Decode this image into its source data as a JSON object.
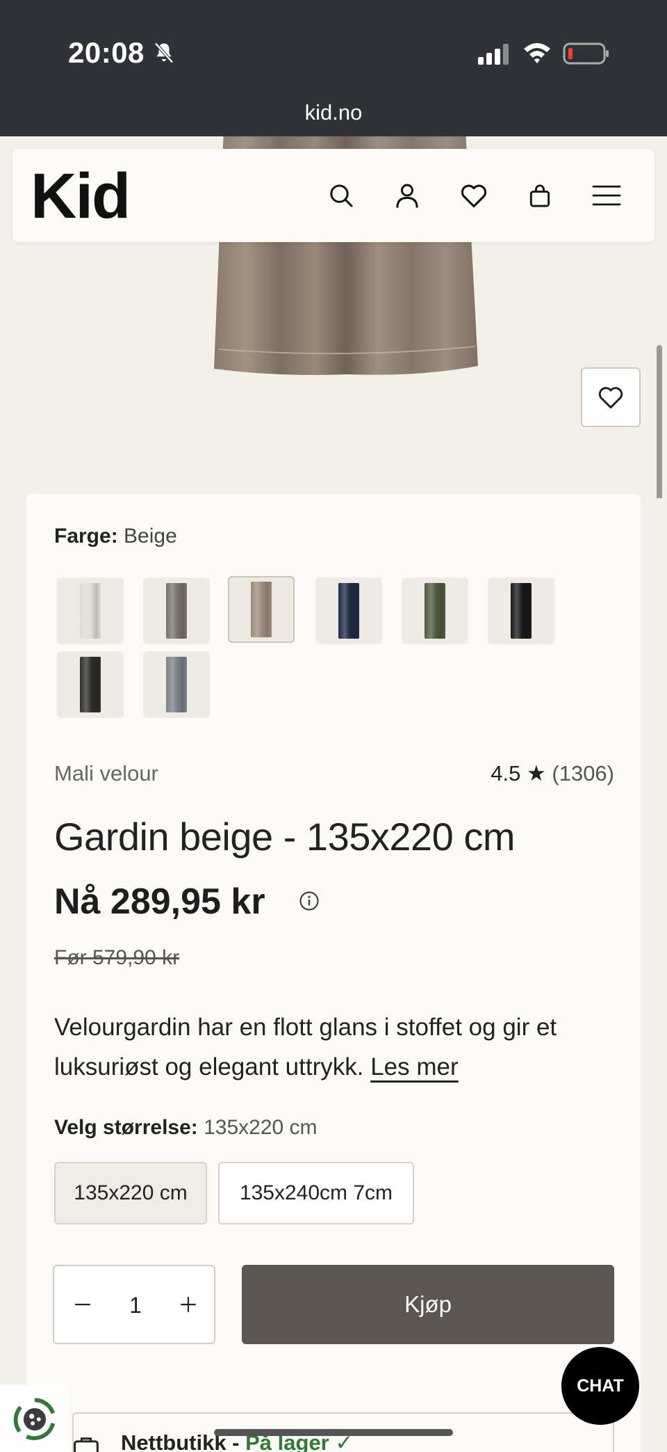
{
  "status_bar": {
    "time": "20:08"
  },
  "browser": {
    "url": "kid.no"
  },
  "header": {
    "logo": "Kid"
  },
  "product": {
    "color_label": "Farge:",
    "color_value": "Beige",
    "swatches": [
      {
        "name": "white",
        "color": "#dedbd5"
      },
      {
        "name": "grey-brown",
        "color": "#7a716b"
      },
      {
        "name": "beige",
        "color": "#9c8b7c"
      },
      {
        "name": "navy",
        "color": "#1f2a44"
      },
      {
        "name": "olive",
        "color": "#4e5a3c"
      },
      {
        "name": "black",
        "color": "#1a1a1a"
      },
      {
        "name": "charcoal",
        "color": "#2e2e2c"
      },
      {
        "name": "blue-grey",
        "color": "#7c7f88"
      }
    ],
    "subtitle": "Mali velour",
    "rating": "4.5 ★",
    "rating_count": "(1306)",
    "title": "Gardin beige - 135x220 cm",
    "price_now": "Nå 289,95 kr",
    "price_before": "Før 579,90 kr",
    "description": "Velourgardin har en flott glans i stoffet og gir et luksuriøst og elegant uttrykk.",
    "read_more": "Les mer",
    "size_label": "Velg størrelse:",
    "size_value": "135x220 cm",
    "sizes": [
      "135x220 cm",
      "135x240cm 7cm"
    ],
    "quantity": "1",
    "buy_label": "Kjøp",
    "stock_label": "Nettbutikk - ",
    "stock_status": "På lager ✓"
  },
  "chat": {
    "label": "CHAT"
  },
  "colors": {
    "accent": "#5b5651",
    "background": "#f3f0ea",
    "card": "#fbfaf6",
    "in_stock": "#2f7a36"
  }
}
